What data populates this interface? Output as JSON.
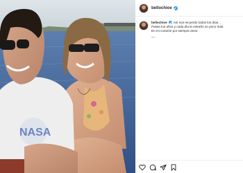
{
  "post": {
    "username": "bellochioe",
    "caption_lines": [
      "Así nos recuerdo todos los días...",
      "Pasan los años y cada día te extraño un poco más.",
      "En mi corazón por siempre amor."
    ],
    "time": "4 h",
    "photo_shirt_text": "NASA"
  },
  "icons": {
    "like": "heart-icon",
    "comment": "comment-icon",
    "share": "share-icon",
    "save": "bookmark-icon",
    "verified": "verified-badge-icon"
  },
  "colors": {
    "verified": "#3897f0",
    "text": "#262626",
    "muted": "#8e8e8e",
    "divider": "#efefef"
  }
}
